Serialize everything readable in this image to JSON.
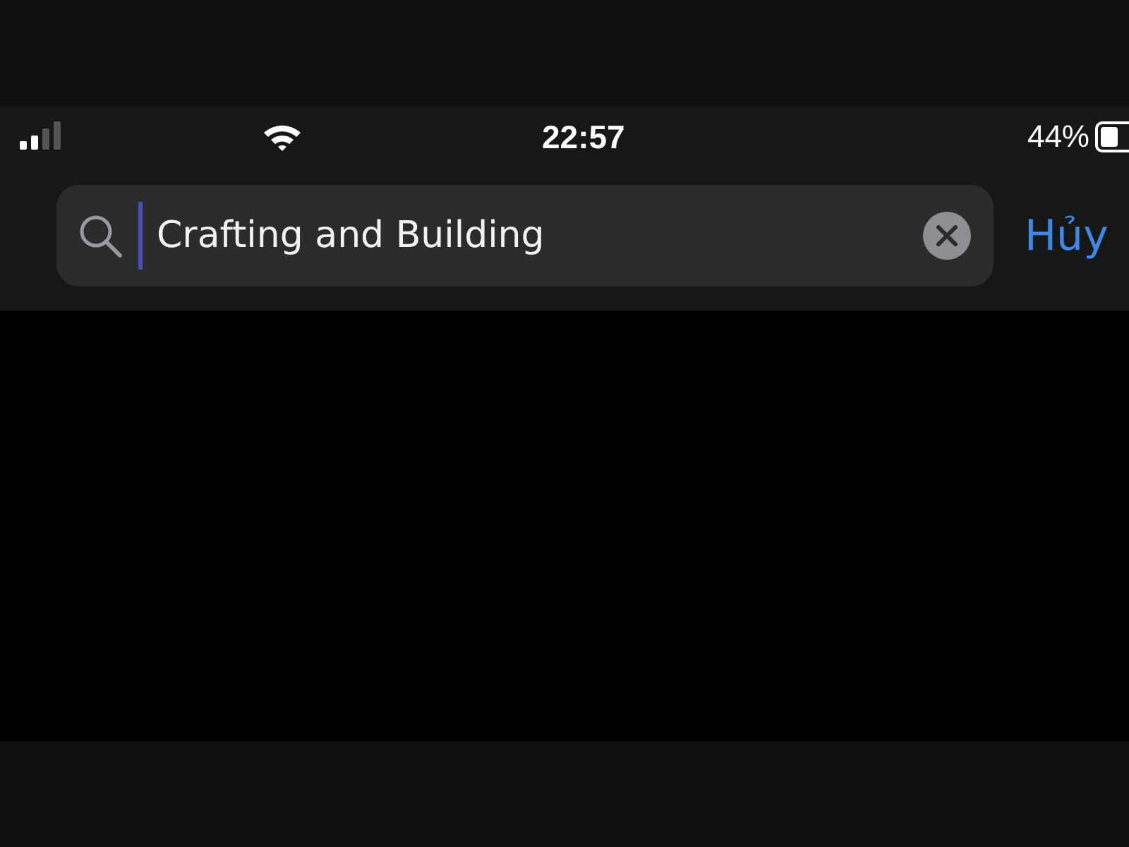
{
  "status_bar": {
    "time": "22:57",
    "battery": "44%"
  },
  "search": {
    "value": "Crafting and Building",
    "cancel": "Hủy"
  }
}
